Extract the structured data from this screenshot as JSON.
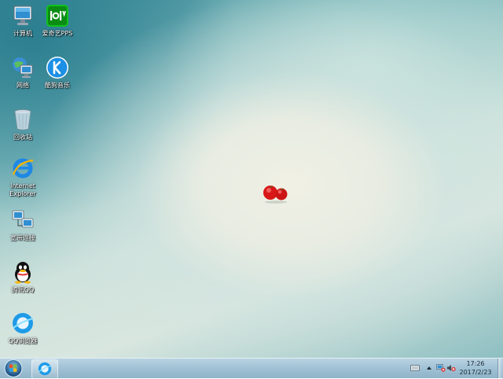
{
  "desktop": {
    "icons": [
      {
        "label": "计算机",
        "icon": "computer-icon"
      },
      {
        "label": "爱奇艺PPS",
        "icon": "iqiyi-icon"
      },
      {
        "label": "网络",
        "icon": "network-icon"
      },
      {
        "label": "酷狗音乐",
        "icon": "kugou-icon"
      },
      {
        "label": "回收站",
        "icon": "recycle-bin-icon"
      },
      {
        "label": "Internet\nExplorer",
        "icon": "internet-explorer-icon"
      },
      {
        "label": "宽带连接",
        "icon": "broadband-connection-icon"
      },
      {
        "label": "腾讯QQ",
        "icon": "qq-icon"
      },
      {
        "label": "QQ浏览器",
        "icon": "qq-browser-icon"
      }
    ],
    "wallpaper_logo": "tomato-icon"
  },
  "taskbar": {
    "start_icon": "windows-logo-icon",
    "pinned": [
      {
        "icon": "qq-browser-icon"
      }
    ],
    "tray": {
      "icons": [
        "keyboard-icon",
        "arrow-up-icon",
        "network-status-icon",
        "volume-muted-icon"
      ],
      "time": "17:26",
      "date": "2017/2/23"
    }
  },
  "colors": {
    "taskbar": "#a3c3d6",
    "desktop_center": "#eef0e4",
    "desktop_edge": "#3e8d9a"
  }
}
